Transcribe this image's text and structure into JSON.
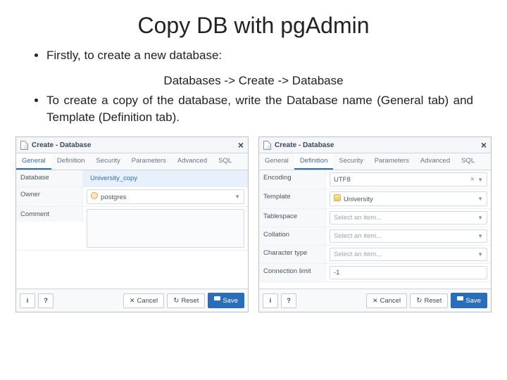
{
  "slide": {
    "title": "Copy DB with pgAdmin",
    "bullet1": "Firstly, to create a new database:",
    "path": "Databases -> Create -> Database",
    "bullet2": "To create a copy of the database, write the Database name (General tab) and Template (Definition tab)."
  },
  "dialog": {
    "title": "Create - Database",
    "tabs": [
      "General",
      "Definition",
      "Security",
      "Parameters",
      "Advanced",
      "SQL"
    ],
    "footer": {
      "info": "i",
      "help": "?",
      "cancel": "Cancel",
      "reset": "Reset",
      "save": "Save"
    }
  },
  "left": {
    "active_tab": 0,
    "fields": {
      "database_label": "Database",
      "database_value": "University_copy",
      "owner_label": "Owner",
      "owner_value": "postgres",
      "comment_label": "Comment",
      "comment_value": ""
    }
  },
  "right": {
    "active_tab": 1,
    "fields": {
      "encoding_label": "Encoding",
      "encoding_value": "UTF8",
      "template_label": "Template",
      "template_value": "University",
      "tablespace_label": "Tablespace",
      "tablespace_value": "Select an item...",
      "collation_label": "Collation",
      "collation_value": "Select an item...",
      "chartype_label": "Character type",
      "chartype_value": "Select an item...",
      "connlimit_label": "Connection limit",
      "connlimit_value": "-1"
    }
  }
}
